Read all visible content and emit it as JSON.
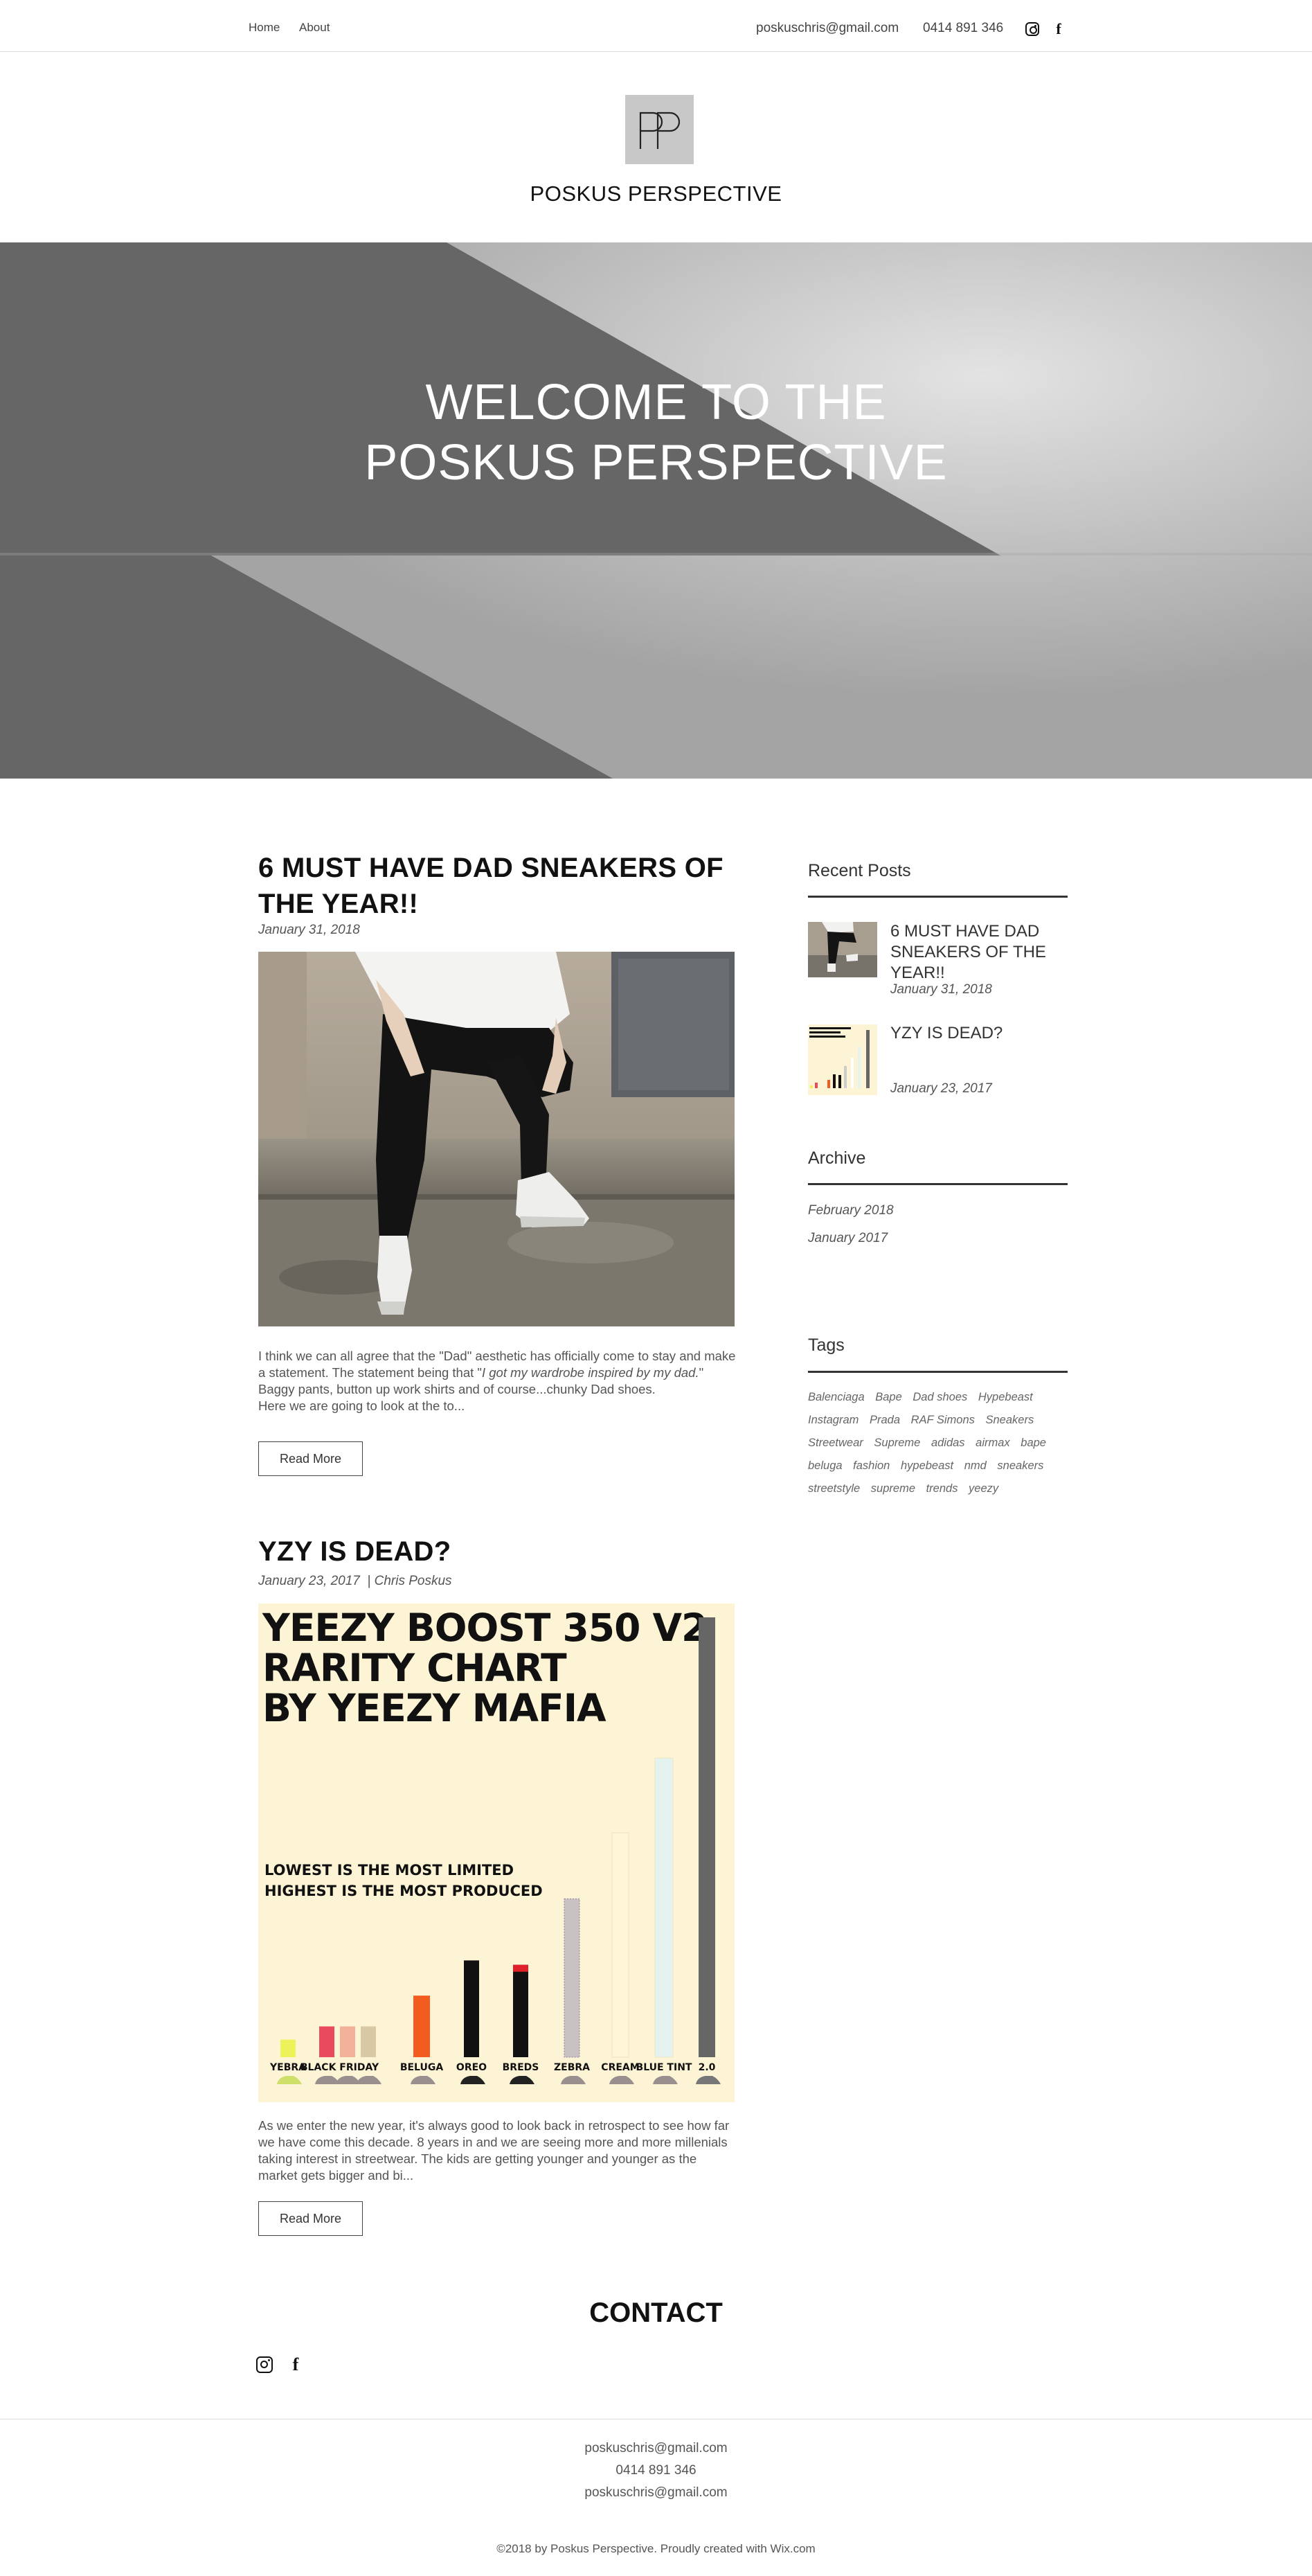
{
  "nav": {
    "home": "Home",
    "about": "About"
  },
  "header_contact": {
    "email": "poskuschris@gmail.com",
    "phone": "0414 891 346"
  },
  "site": {
    "logo_text": "PP",
    "title": "POSKUS PERSPECTIVE"
  },
  "hero": {
    "line1": "WELCOME TO THE",
    "line2": "POSKUS PERSPECTIVE"
  },
  "posts": [
    {
      "title_line1": "6 MUST HAVE DAD SNEAKERS OF",
      "title_line2": "THE YEAR!!",
      "date": "January 31, 2018",
      "excerpt_a": "I think we can all agree that the \"Dad\" aesthetic has officially come to stay and make a statement. The statement being that \"",
      "excerpt_quote": "I got my wardrobe inspired by my dad.",
      "excerpt_b": "\" Baggy pants, button up work shirts and of course...chunky Dad shoes.",
      "excerpt_c": "Here we are going to look at the to...",
      "read_more": "Read More"
    },
    {
      "title": "YZY IS DEAD?",
      "date": "January 23, 2017",
      "author": "Chris Poskus",
      "excerpt": "As we enter the new year, it's always good to look back in retrospect to see how far we have come this decade. 8 years in and we are seeing more and more millenials taking interest in streetwear. The kids are getting younger and younger as the market gets bigger and bi...",
      "read_more": "Read More"
    }
  ],
  "chart_data": {
    "type": "bar",
    "title": "YEEZY BOOST 350 V2 RARITY CHART BY YEEZY MAFIA",
    "title_lines": [
      "YEEZY BOOST 350 V2",
      "RARITY CHART",
      "BY YEEZY MAFIA"
    ],
    "subtitle_lines": [
      "LOWEST IS THE MOST LIMITED",
      "HIGHEST IS THE MOST PRODUCED"
    ],
    "categories": [
      "YEBRA",
      "BLACK FRIDAY",
      "BELUGA",
      "OREO",
      "BREDS",
      "ZEBRA",
      "CREAM",
      "BLUE TINT",
      "2.0"
    ],
    "values": [
      2,
      3.5,
      7,
      11,
      10.5,
      18,
      25.5,
      34,
      50
    ],
    "colors": [
      "#eef25a",
      "#e94a5c",
      "#f25c1f",
      "#111111",
      "#111111",
      "#c9c2c2",
      "#fff6d8",
      "#e4f3ef",
      "#666666"
    ],
    "ylim": [
      0,
      50
    ]
  },
  "sidebar": {
    "recent_heading": "Recent Posts",
    "recent": [
      {
        "title": "6 MUST HAVE DAD SNEAKERS OF THE YEAR!!",
        "date": "January 31, 2018"
      },
      {
        "title": "YZY IS DEAD?",
        "date": "January 23, 2017"
      }
    ],
    "archive_heading": "Archive",
    "archive": [
      "February 2018",
      "January 2017"
    ],
    "tags_heading": "Tags",
    "tags": [
      "Balenciaga",
      "Bape",
      "Dad shoes",
      "Hypebeast",
      "Instagram",
      "Prada",
      "RAF Simons",
      "Sneakers",
      "Streetwear",
      "Supreme",
      "adidas",
      "airmax",
      "bape",
      "beluga",
      "fashion",
      "hypebeast",
      "nmd",
      "sneakers",
      "streetstyle",
      "supreme",
      "trends",
      "yeezy"
    ]
  },
  "contact": {
    "title": "CONTACT"
  },
  "footer": {
    "email1": "poskuschris@gmail.com",
    "phone": "0414 891 346",
    "email2": "poskuschris@gmail.com",
    "copyright": "©2018 by Poskus Perspective. Proudly created with Wix.com"
  }
}
